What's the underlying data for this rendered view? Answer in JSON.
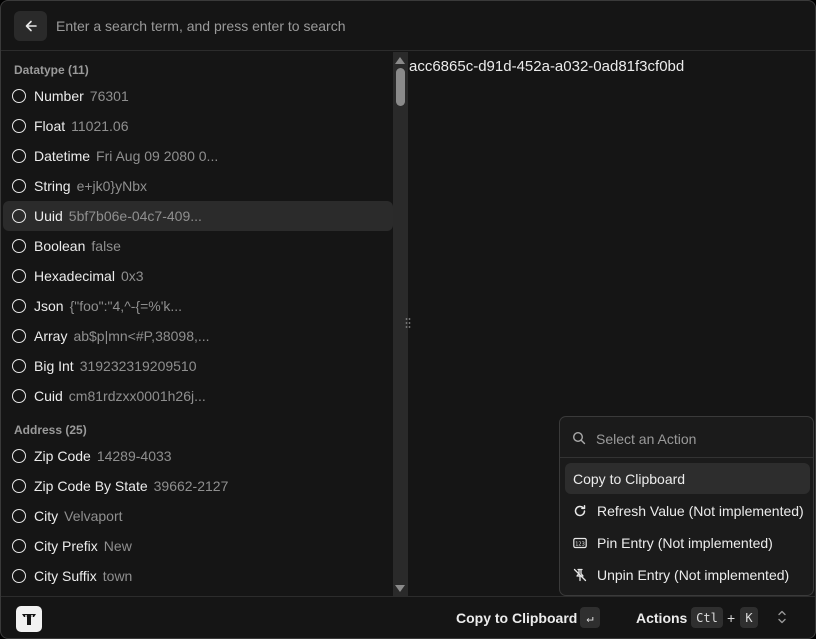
{
  "header": {
    "search_placeholder": "Enter a search term, and press enter to search"
  },
  "sections": [
    {
      "title": "Datatype (11)",
      "items": [
        {
          "name": "Number",
          "value": "76301"
        },
        {
          "name": "Float",
          "value": "11021.06"
        },
        {
          "name": "Datetime",
          "value": "Fri Aug 09 2080 0..."
        },
        {
          "name": "String",
          "value": "e+jk0}yNbx"
        },
        {
          "name": "Uuid",
          "value": "5bf7b06e-04c7-409..."
        },
        {
          "name": "Boolean",
          "value": "false"
        },
        {
          "name": "Hexadecimal",
          "value": "0x3"
        },
        {
          "name": "Json",
          "value": "{\"foo\":\"4,^-{=%'k..."
        },
        {
          "name": "Array",
          "value": "ab$p|mn<#P,38098,..."
        },
        {
          "name": "Big Int",
          "value": "319232319209510"
        },
        {
          "name": "Cuid",
          "value": "cm81rdzxx0001h26j..."
        }
      ]
    },
    {
      "title": "Address (25)",
      "items": [
        {
          "name": "Zip Code",
          "value": "14289-4033"
        },
        {
          "name": "Zip Code By State",
          "value": "39662-2127"
        },
        {
          "name": "City",
          "value": "Velvaport"
        },
        {
          "name": "City Prefix",
          "value": "New"
        },
        {
          "name": "City Suffix",
          "value": "town"
        }
      ]
    }
  ],
  "selected_item": "Uuid",
  "detail": {
    "value": "acc6865c-d91d-452a-a032-0ad81f3cf0bd"
  },
  "action_menu": {
    "search_placeholder": "Select an Action",
    "items": [
      {
        "label": "Copy to Clipboard",
        "icon": "none"
      },
      {
        "label": "Refresh Value (Not implemented)",
        "icon": "refresh-icon"
      },
      {
        "label": "Pin Entry (Not implemented)",
        "icon": "number-pad-icon"
      },
      {
        "label": "Unpin Entry (Not implemented)",
        "icon": "pin-off-icon"
      }
    ]
  },
  "footer": {
    "primary_action": "Copy to Clipboard",
    "enter_key": "↵",
    "actions_label": "Actions",
    "ctrl_key": "Ctl",
    "plus": "+",
    "k_key": "K"
  }
}
